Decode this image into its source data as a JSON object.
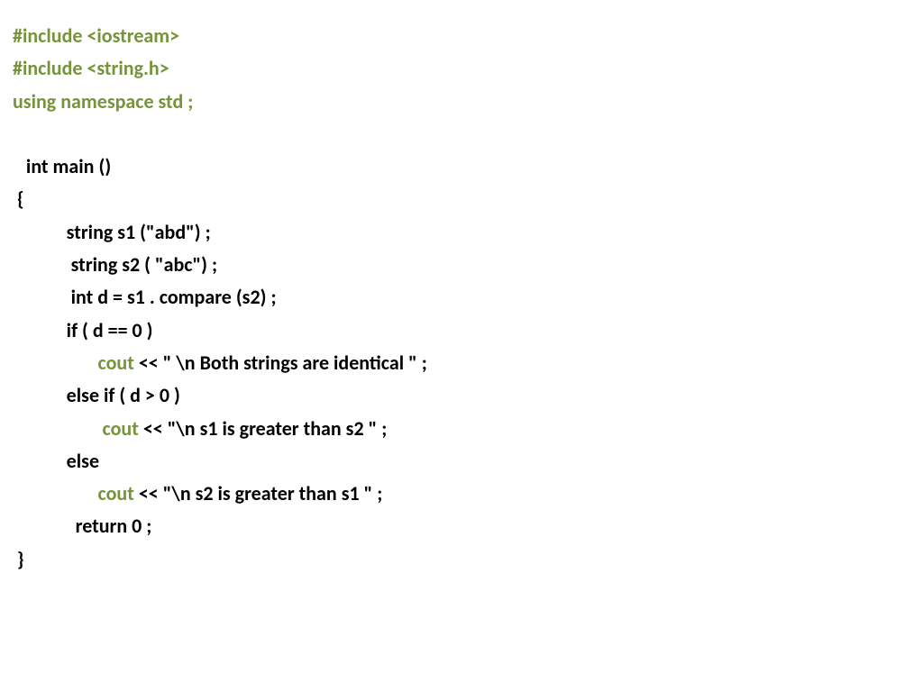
{
  "code": {
    "l1": "#include <iostream>",
    "l2": "#include <string.h>",
    "l3": "using namespace std ;",
    "l4": " ",
    "l5": "   int main ()",
    "l6": " {",
    "l7": "            string s1 (\"abd\") ;",
    "l8": "             string s2 ( \"abc\") ;",
    "l9": "             int d = s1 . compare (s2) ;",
    "l10": "            if ( d == 0 )",
    "l11a": "                   ",
    "l11b": "cout",
    "l11c": " << \" \\n Both strings are identical \" ;",
    "l12": "            else if ( d > 0 )",
    "l13a": "                    ",
    "l13b": "cout",
    "l13c": " << \"\\n s1 is greater than s2 \" ;",
    "l14": "            else",
    "l15a": "                   ",
    "l15b": "cout",
    "l15c": " << \"\\n s2 is greater than s1 \" ;",
    "l16": "              return 0 ;",
    "l17": " }"
  }
}
